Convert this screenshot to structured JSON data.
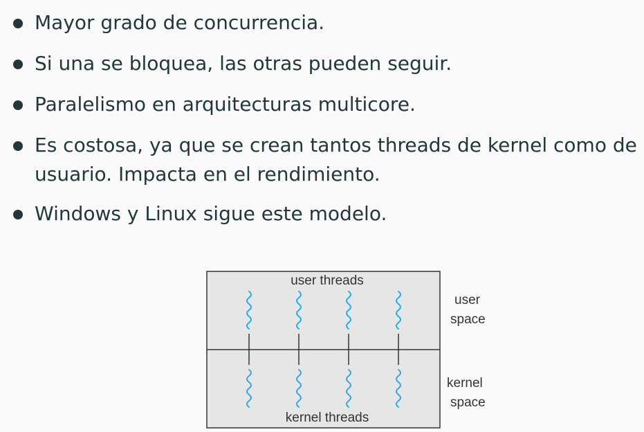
{
  "bullets": [
    "Mayor grado de concurrencia.",
    "Si una se bloquea, las otras pueden seguir.",
    "Paralelismo en arquitecturas multicore.",
    "Es costosa, ya que se crean tantos threads de kernel como de",
    "usuario. Impacta en el rendimiento.",
    "Windows y Linux sigue este modelo."
  ],
  "diagram": {
    "user_threads_label": "user threads",
    "kernel_threads_label": "kernel threads",
    "user_space_line1": "user",
    "user_space_line2": "space",
    "kernel_space_line1": "kernel",
    "kernel_space_line2": "space",
    "thread_count": 4,
    "colors": {
      "thread": "#29abe2",
      "box_fill": "#e6e6e6",
      "box_stroke": "#333333",
      "text": "#333333"
    }
  }
}
